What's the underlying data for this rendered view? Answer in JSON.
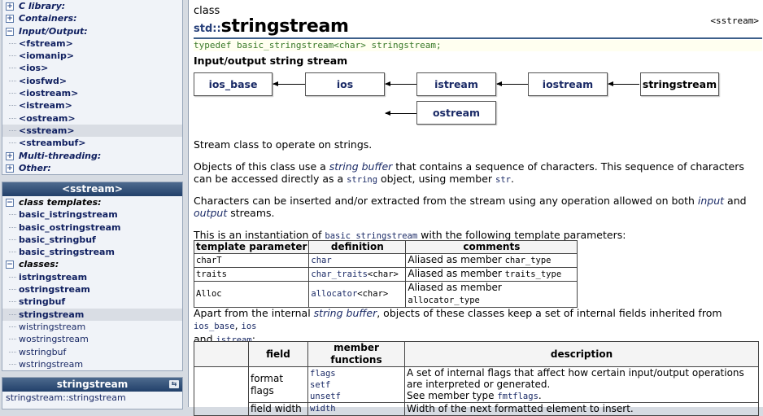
{
  "sidebar": {
    "top_panel": {
      "categories": [
        {
          "label": "C library:",
          "state": "collapsed"
        },
        {
          "label": "Containers:",
          "state": "collapsed"
        },
        {
          "label": "Input/Output:",
          "state": "expanded",
          "items": [
            "<fstream>",
            "<iomanip>",
            "<ios>",
            "<iosfwd>",
            "<iostream>",
            "<istream>",
            "<ostream>",
            "<sstream>",
            "<streambuf>"
          ],
          "selected": "<sstream>"
        },
        {
          "label": "Multi-threading:",
          "state": "collapsed"
        },
        {
          "label": "Other:",
          "state": "collapsed"
        }
      ]
    },
    "header_panel": {
      "title": "<sstream>",
      "groups": [
        {
          "label": "class templates:",
          "items": [
            "basic_istringstream",
            "basic_ostringstream",
            "basic_stringbuf",
            "basic_stringstream"
          ]
        },
        {
          "label": "classes:",
          "items": [
            "istringstream",
            "ostringstream",
            "stringbuf",
            "stringstream",
            "wistringstream",
            "wostringstream",
            "wstringbuf",
            "wstringstream"
          ],
          "selected": "stringstream"
        }
      ]
    },
    "member_panel": {
      "title": "stringstream",
      "icon": "toggle-panel-icon",
      "items": [
        "stringstream::stringstream"
      ]
    }
  },
  "main": {
    "kind": "class",
    "namespace": "std::",
    "name": "stringstream",
    "header": "<sstream>",
    "typedef": "typedef basic_stringstream<char> stringstream;",
    "subtitle": "Input/output string stream",
    "diagram": {
      "boxes": [
        "ios_base",
        "ios",
        "istream",
        "iostream",
        "stringstream",
        "ostream"
      ]
    },
    "intro": "Stream class to operate on strings.",
    "p1": {
      "a": "Objects of this class use a ",
      "b": "string buffer",
      "c": " that contains a sequence of characters. This sequence of characters can be accessed directly as a ",
      "d": "string",
      "e": " object, using member ",
      "f": "str",
      "g": "."
    },
    "p2": {
      "a": "Characters can be inserted and/or extracted from the stream using any operation allowed on both ",
      "b": "input",
      "c": " and ",
      "d": "output",
      "e": " streams."
    },
    "p3": {
      "a": "This is an instantiation of ",
      "b": "basic_stringstream",
      "c": " with the following template parameters:"
    },
    "template_table": {
      "headers": [
        "template parameter",
        "definition",
        "comments"
      ],
      "rows": [
        {
          "param": "charT",
          "def_link": "char",
          "def_rest": "",
          "comment": "Aliased as member ",
          "member": "char_type"
        },
        {
          "param": "traits",
          "def_link": "char_traits",
          "def_rest": "<char>",
          "comment": "Aliased as member ",
          "member": "traits_type"
        },
        {
          "param": "Alloc",
          "def_link": "allocator",
          "def_rest": "<char>",
          "comment": "Aliased as member ",
          "member": "allocator_type"
        }
      ]
    },
    "p4": {
      "a": "Apart from the internal ",
      "b": "string buffer",
      "c": ", objects of these classes keep a set of internal fields inherited from ",
      "d": "ios_base",
      "e": ", ",
      "f": "ios",
      "g": " and ",
      "h": "istream",
      "i": ":"
    },
    "fields_table": {
      "headers": [
        "",
        "field",
        "member functions",
        "description"
      ],
      "rows": [
        {
          "field": "format flags",
          "functions": [
            "flags",
            "setf",
            "unsetf"
          ],
          "desc_a": "A set of internal flags that affect how certain input/output operations are interpreted or generated.",
          "desc_b": "See member type ",
          "desc_code": "fmtflags",
          "desc_c": "."
        },
        {
          "field": "field width",
          "functions": [
            "width"
          ],
          "desc_a": "Width of the next formatted element to insert."
        }
      ]
    }
  }
}
